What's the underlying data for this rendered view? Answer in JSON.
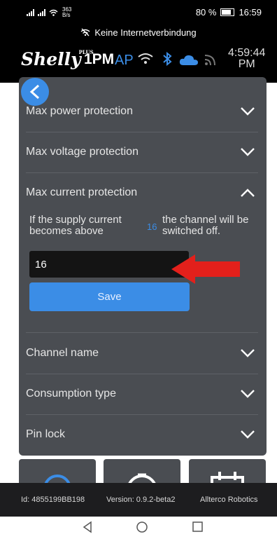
{
  "status_bar": {
    "net_rate_value": "363",
    "net_rate_unit": "B/s",
    "battery": "80 %",
    "time": "16:59"
  },
  "network_notice": "Keine Internetverbindung",
  "header": {
    "logo": "Shelly",
    "logo_plus": "PLUS",
    "model": "1PM",
    "ap_label": "AP",
    "clock_line1": "4:59:44",
    "clock_line2": "PM"
  },
  "settings": {
    "rows_top": [
      {
        "label": "Max power protection"
      },
      {
        "label": "Max voltage protection"
      },
      {
        "label": "Max current protection"
      }
    ],
    "current_protection": {
      "text_before": "If the supply current becomes above",
      "value_inline": "16",
      "text_after": "the channel will be switched off.",
      "input_value": "16",
      "save_label": "Save"
    },
    "rows_bottom": [
      {
        "label": "Channel name"
      },
      {
        "label": "Consumption type"
      },
      {
        "label": "Pin lock"
      }
    ]
  },
  "footer": {
    "id": "Id: 4855199BB198",
    "version": "Version: 0.9.2-beta2",
    "vendor": "Allterco Robotics"
  },
  "colors": {
    "accent": "#3b8de6",
    "panel": "#4a4d52",
    "arrow": "#e3201b"
  },
  "icons": [
    "wifi-icon",
    "bluetooth-icon",
    "cloud-icon",
    "rss-icon",
    "back-icon",
    "chevron-down-icon",
    "chevron-up-icon",
    "nav-back-icon",
    "nav-home-icon",
    "nav-recents-icon"
  ]
}
